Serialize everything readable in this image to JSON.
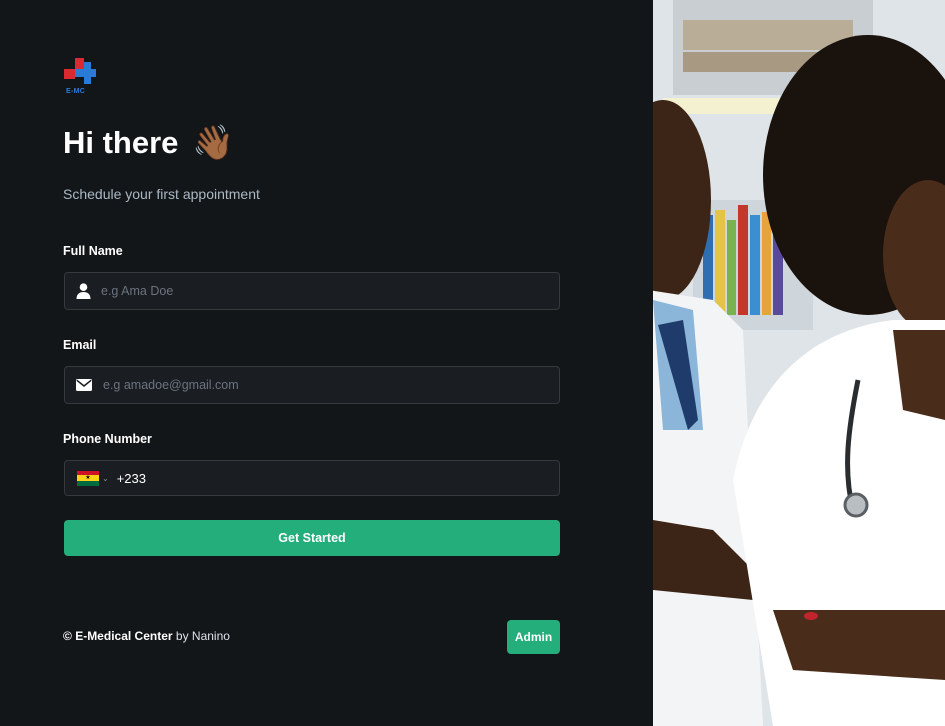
{
  "brand": {
    "logo_text": "E-MC"
  },
  "hero": {
    "greeting": "Hi there",
    "wave_emoji": "👋🏾",
    "subtitle": "Schedule your first appointment"
  },
  "form": {
    "full_name": {
      "label": "Full Name",
      "placeholder": "e.g Ama Doe",
      "icon": "user-icon"
    },
    "email": {
      "label": "Email",
      "placeholder": "e.g amadoe@gmail.com",
      "icon": "envelope-icon"
    },
    "phone": {
      "label": "Phone Number",
      "country_flag": "Ghana",
      "value": "+233"
    },
    "submit_label": "Get Started"
  },
  "footer": {
    "copyright_symbol": "©",
    "company": "E-Medical Center",
    "by_text": "by Nanino",
    "admin_label": "Admin"
  },
  "colors": {
    "background": "#131619",
    "input_bg": "#1a1d21",
    "input_border": "#363a3d",
    "accent_green": "#24ae7c",
    "subtitle": "#abb8c4",
    "logo_red": "#d92a2f",
    "logo_blue": "#2a7bd6"
  }
}
